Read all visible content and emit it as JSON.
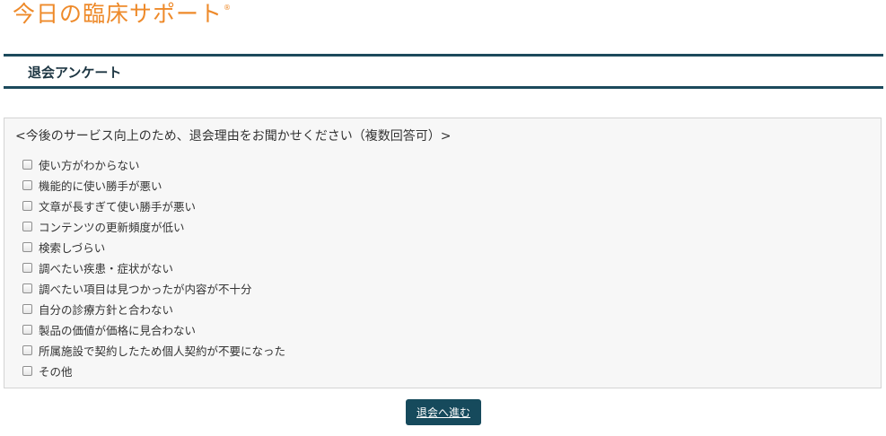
{
  "header": {
    "logo_text": "今日の臨床サポート",
    "logo_mark": "®",
    "page_title": "退会アンケート"
  },
  "survey": {
    "question": "<今後のサービス向上のため、退会理由をお聞かせください（複数回答可）>",
    "options": [
      {
        "label": "使い方がわからない",
        "checked": false
      },
      {
        "label": "機能的に使い勝手が悪い",
        "checked": false
      },
      {
        "label": "文章が長すぎて使い勝手が悪い",
        "checked": false
      },
      {
        "label": "コンテンツの更新頻度が低い",
        "checked": false
      },
      {
        "label": "検索しづらい",
        "checked": false
      },
      {
        "label": "調べたい疾患・症状がない",
        "checked": false
      },
      {
        "label": "調べたい項目は見つかったが内容が不十分",
        "checked": false
      },
      {
        "label": "自分の診療方針と合わない",
        "checked": false
      },
      {
        "label": "製品の価値が価格に見合わない",
        "checked": false
      },
      {
        "label": "所属施設で契約したため個人契約が不要になった",
        "checked": false
      },
      {
        "label": "その他",
        "checked": false
      }
    ]
  },
  "actions": {
    "submit_label": "退会へ進む"
  },
  "colors": {
    "brand_orange": "#ee8a2a",
    "header_rule": "#1c4a5c",
    "button_bg": "#164a5c",
    "panel_bg": "#f7f7f7"
  }
}
